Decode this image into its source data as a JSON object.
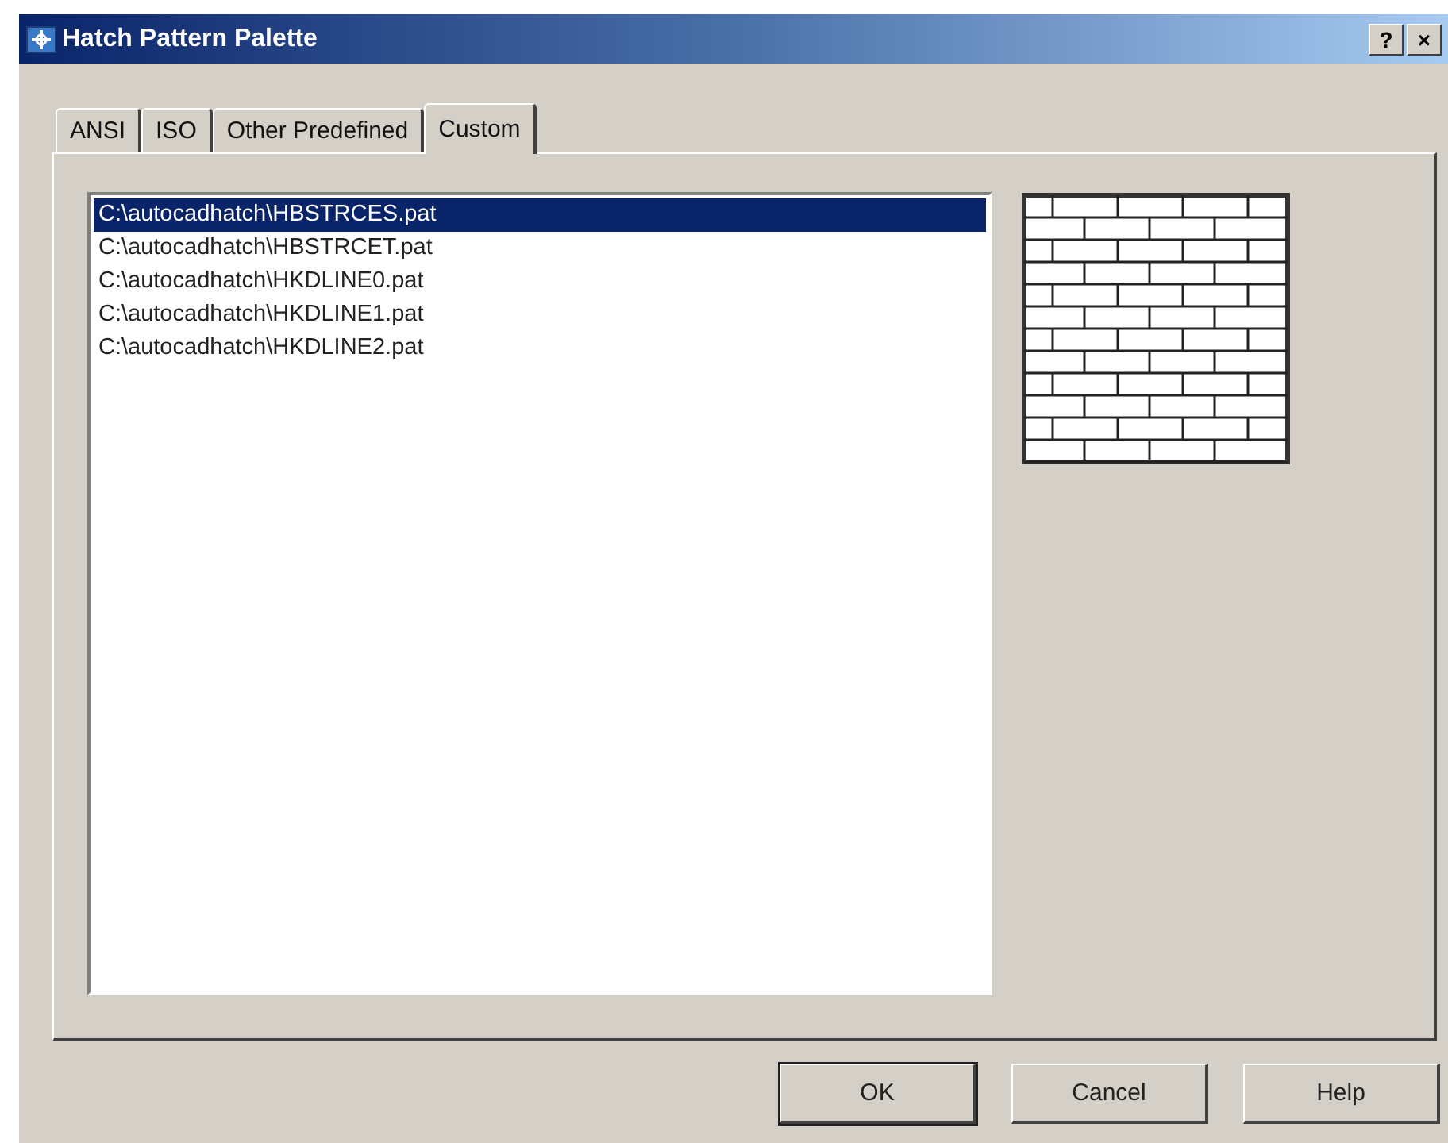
{
  "window": {
    "title": "Hatch Pattern Palette",
    "help_button": "?",
    "close_button": "×"
  },
  "tabs": [
    {
      "label": "ANSI",
      "selected": false
    },
    {
      "label": "ISO",
      "selected": false
    },
    {
      "label": "Other Predefined",
      "selected": false
    },
    {
      "label": "Custom",
      "selected": true
    }
  ],
  "files": [
    {
      "label": "C:\\autocadhatch\\HBSTRCES.pat",
      "selected": true
    },
    {
      "label": "C:\\autocadhatch\\HBSTRCET.pat",
      "selected": false
    },
    {
      "label": "C:\\autocadhatch\\HKDLINE0.pat",
      "selected": false
    },
    {
      "label": "C:\\autocadhatch\\HKDLINE1.pat",
      "selected": false
    },
    {
      "label": "C:\\autocadhatch\\HKDLINE2.pat",
      "selected": false
    }
  ],
  "buttons": [
    {
      "label": "OK",
      "default": true
    },
    {
      "label": "Cancel",
      "default": false
    },
    {
      "label": "Help",
      "default": false
    }
  ]
}
